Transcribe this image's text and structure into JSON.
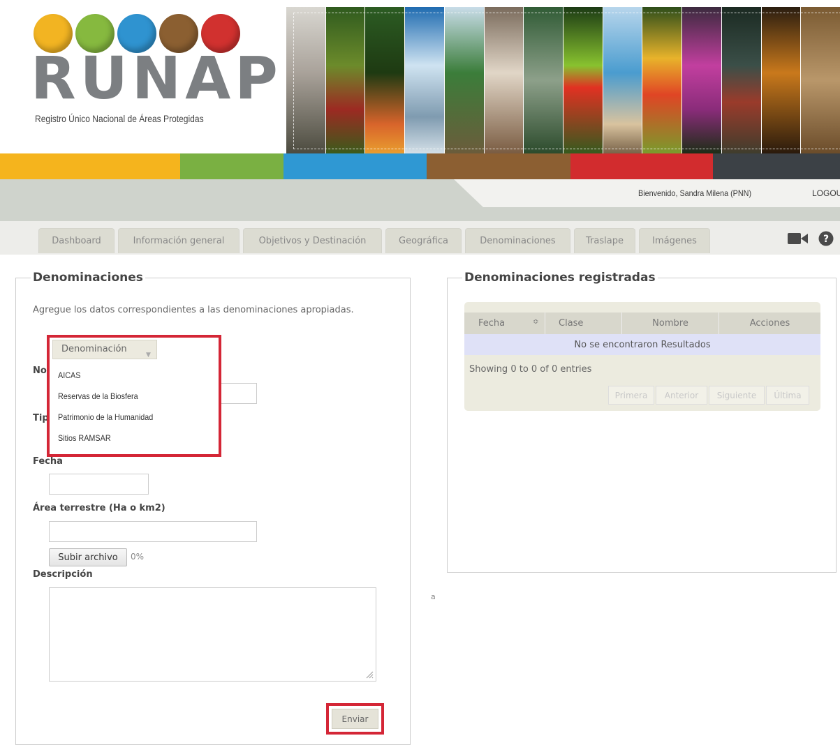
{
  "header": {
    "logo_text": "RUNAP",
    "logo_subtitle": "Registro Único Nacional de Áreas Protegidas",
    "welcome": "Bienvenido, Sandra Milena (PNN)",
    "logout": "LOGOU"
  },
  "brand_colors": [
    "#f5b41d",
    "#7ab042",
    "#2f98d3",
    "#8c5f32",
    "#d22c2e",
    "#3c4146"
  ],
  "tabs": [
    {
      "label": "Dashboard"
    },
    {
      "label": "Información general"
    },
    {
      "label": "Objetivos y Destinación"
    },
    {
      "label": "Geográfica"
    },
    {
      "label": "Denominaciones"
    },
    {
      "label": "Traslape"
    },
    {
      "label": "Imágenes"
    }
  ],
  "toolbar_icons": [
    "video-camera-icon",
    "help-circle-icon"
  ],
  "form": {
    "legend": "Denominaciones",
    "intro": "Agregue los datos correspondientes a las denominaciones apropiadas.",
    "select_label": "Denominación",
    "dropdown_options": [
      "AICAS",
      "Reservas de la Biosfera",
      "Patrimonio de la Humanidad",
      "Sitios RAMSAR"
    ],
    "partial_label_nombre": "No",
    "partial_label_tipo": "Tip",
    "fecha_label": "Fecha",
    "area_label": "Área terrestre (Ha o km2)",
    "upload_button": "Subir archivo",
    "upload_progress": "0%",
    "descripcion_label": "Descripción",
    "submit_button": "Enviar"
  },
  "registered": {
    "legend": "Denominaciones registradas",
    "columns": [
      "Fecha",
      "Clase",
      "Nombre",
      "Acciones"
    ],
    "empty_message": "No se encontraron Resultados",
    "showing": "Showing 0 to 0 of 0 entries",
    "pager": [
      "Primera",
      "Anterior",
      "Siguiente",
      "Última"
    ]
  },
  "stray_text": "a"
}
